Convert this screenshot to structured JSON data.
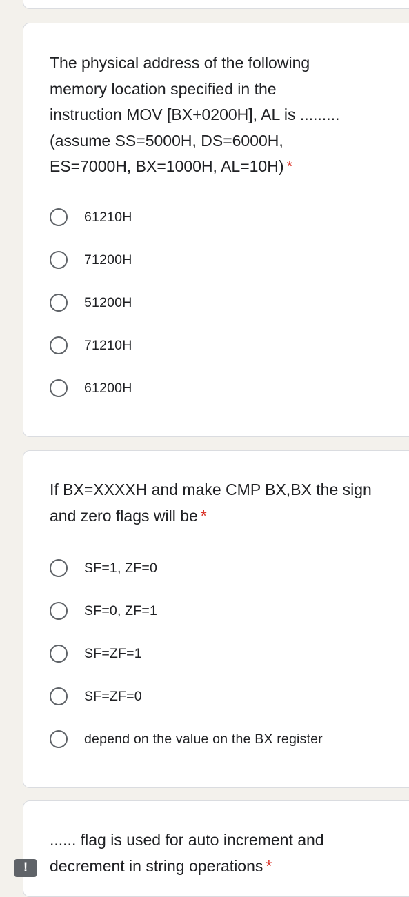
{
  "questions": [
    {
      "lines": [
        "The physical address of the following",
        "memory location specified in the",
        "instruction MOV [BX+0200H], AL is .........",
        "(assume SS=5000H, DS=6000H,",
        "ES=7000H, BX=1000H, AL=10H)"
      ],
      "required_mark": "*",
      "options": [
        "61210H",
        "71200H",
        "51200H",
        "71210H",
        "61200H"
      ]
    },
    {
      "lines": [
        "If BX=XXXXH and make CMP BX,BX the sign",
        "and zero flags will be"
      ],
      "required_mark": "*",
      "options": [
        "SF=1, ZF=0",
        "SF=0, ZF=1",
        "SF=ZF=1",
        "SF=ZF=0",
        "depend on the value on the BX register"
      ]
    },
    {
      "lines": [
        "...... flag is used for auto increment and",
        "decrement in string operations"
      ],
      "required_mark": "*"
    }
  ],
  "alert_icon": "exclamation-icon",
  "alert_symbol": "!"
}
